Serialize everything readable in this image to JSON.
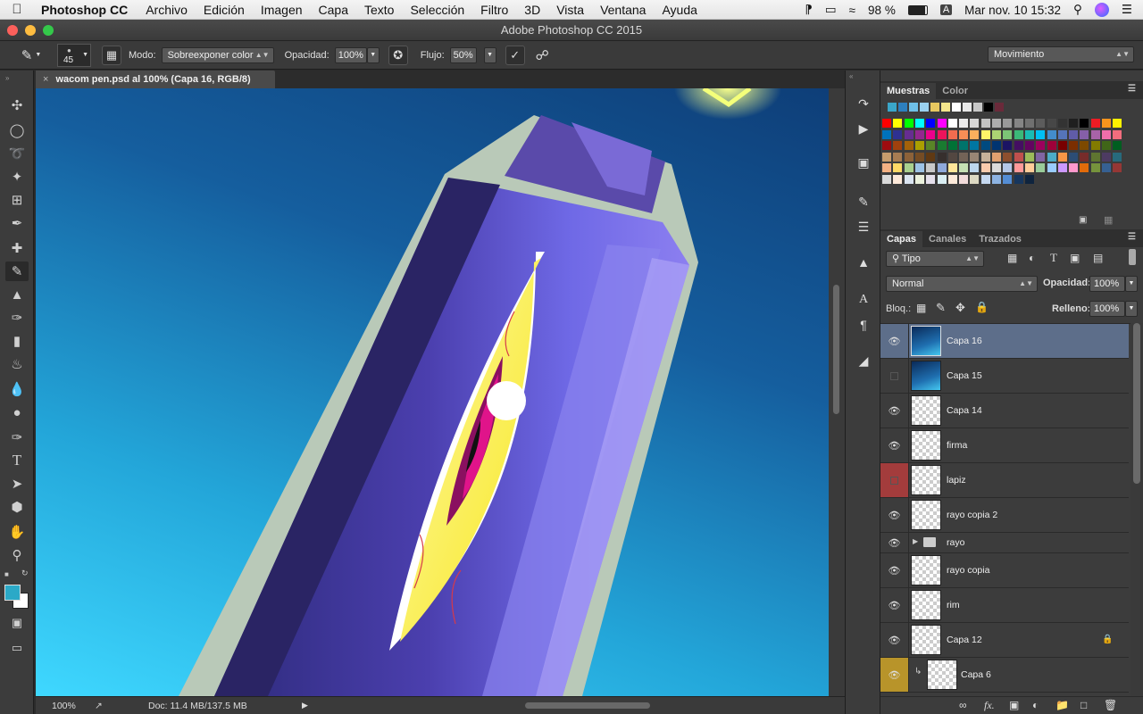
{
  "menubar": {
    "app_name": "Photoshop CC",
    "items": [
      "Archivo",
      "Edición",
      "Imagen",
      "Capa",
      "Texto",
      "Selección",
      "Filtro",
      "3D",
      "Vista",
      "Ventana",
      "Ayuda"
    ],
    "battery": "98 %",
    "input_source": "A",
    "clock": "Mar nov. 10  15:32"
  },
  "window": {
    "title": "Adobe Photoshop CC 2015"
  },
  "options_bar": {
    "brush_size": "45",
    "mode_label": "Modo:",
    "mode_value": "Sobreexponer color",
    "opacity_label": "Opacidad:",
    "opacity_value": "100%",
    "flow_label": "Flujo:",
    "flow_value": "50%",
    "workspace": "Movimiento"
  },
  "document": {
    "tab_title": "wacom pen.psd al 100% (Capa 16, RGB/8)"
  },
  "status_bar": {
    "zoom": "100%",
    "doc_info": "Doc: 11.4 MB/137.5 MB"
  },
  "swatches_panel": {
    "tabs": [
      "Muestras",
      "Color"
    ]
  },
  "layers_panel": {
    "tabs": [
      "Capas",
      "Canales",
      "Trazados"
    ],
    "filter_kind": "Tipo",
    "blend_mode": "Normal",
    "opacity_label": "Opacidad:",
    "opacity_value": "100%",
    "lock_label": "Bloq.:",
    "fill_label": "Relleno:",
    "fill_value": "100%",
    "layers": [
      {
        "name": "Capa 16",
        "visible": true,
        "selected": true,
        "thumb": "image"
      },
      {
        "name": "Capa 15",
        "visible": false,
        "selected": false,
        "thumb": "image"
      },
      {
        "name": "Capa 14",
        "visible": true,
        "selected": false,
        "thumb": "transparent"
      },
      {
        "name": "firma",
        "visible": true,
        "selected": false,
        "thumb": "transparent"
      },
      {
        "name": "lapiz",
        "visible": false,
        "selected": false,
        "thumb": "transparent",
        "label_color": "#a33c3c"
      },
      {
        "name": "rayo copia 2",
        "visible": true,
        "selected": false,
        "thumb": "transparent"
      },
      {
        "name": "rayo",
        "visible": true,
        "selected": false,
        "thumb": "folder"
      },
      {
        "name": "rayo copia",
        "visible": true,
        "selected": false,
        "thumb": "transparent"
      },
      {
        "name": "rim",
        "visible": true,
        "selected": false,
        "thumb": "transparent"
      },
      {
        "name": "Capa 12",
        "visible": true,
        "selected": false,
        "thumb": "transparent",
        "locked": true
      },
      {
        "name": "Capa 6",
        "visible": true,
        "selected": false,
        "thumb": "transparent",
        "label_color": "#b8942a",
        "clipped": true
      }
    ]
  },
  "colors": {
    "foreground": "#2ba9c7",
    "background": "#ffffff",
    "selection": "#5d6e8a"
  }
}
